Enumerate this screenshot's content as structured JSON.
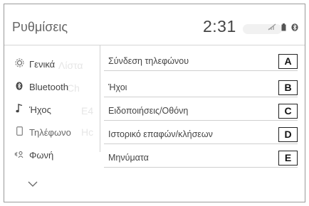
{
  "header": {
    "title": "Ρυθμίσεις",
    "time": "2:31",
    "icons": [
      "no-signal-icon",
      "phone-battery-icon",
      "bluetooth-icon"
    ]
  },
  "sidebar": {
    "items": [
      {
        "label": "Γενικά",
        "icon": "gear-icon"
      },
      {
        "label": "Bluetooth",
        "icon": "bluetooth-icon"
      },
      {
        "label": "Ήχος",
        "icon": "music-note-icon"
      },
      {
        "label": "Τηλέφωνο",
        "icon": "phone-icon",
        "selected": true
      },
      {
        "label": "Φωνή",
        "icon": "voice-icon"
      }
    ],
    "more_icon": "chevron-down-icon"
  },
  "main": {
    "items": [
      {
        "label": "Σύνδεση τηλεφώνου",
        "badge": "A"
      },
      {
        "label": "Ήχοι",
        "badge": "B"
      },
      {
        "label": "Ειδοποιήσεις/Οθόνη",
        "badge": "C"
      },
      {
        "label": "Ιστορικό επαφών/κλήσεων",
        "badge": "D"
      },
      {
        "label": "Μηνύματα",
        "badge": "E"
      }
    ]
  }
}
